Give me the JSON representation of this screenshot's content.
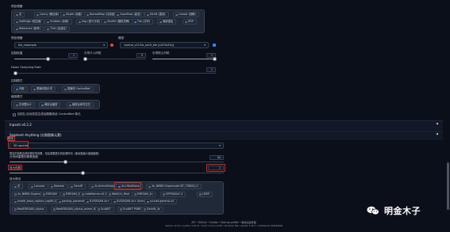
{
  "preprocessor": {
    "title": "预处理器",
    "options": [
      "无",
      "Canny (硬边缘)",
      "Depth (深度)",
      "NormalMap (法线贴图)",
      "OpenPose (姿态)",
      "MLSD (直线)",
      "Lineart (线稿)",
      "SoftEdge (软边缘)",
      "Scribble (涂鸦)",
      "Seg (语义分割)",
      "Shuffle (随机洗牌)",
      "Tile (分块)",
      "局部重绘",
      "IP2P",
      "Reference (参考)",
      "T2IA (自适应)"
    ],
    "selected": "Tile (分块)"
  },
  "preprocessor_select": {
    "label": "预处理器",
    "value": "tile_resample"
  },
  "model_select": {
    "label": "模型",
    "value": "control_v11f1e_sd15_tile [a371b31b]"
  },
  "sliders": {
    "control_weight": {
      "label": "控制权重",
      "value": "1"
    },
    "start_step": {
      "label": "引导介入时机",
      "value": "0"
    },
    "end_step": {
      "label": "引导终止时机",
      "value": "1"
    },
    "down_sampling": {
      "label": "Down Sampling Rate",
      "value": "1"
    }
  },
  "control_mode": {
    "label": "控制模式",
    "options": [
      "均衡",
      "更偏向提示词",
      "更偏向 ControlNet"
    ],
    "selected": "均衡"
  },
  "resize_mode": {
    "label": "缩放模式",
    "options": [
      "仅调整大小",
      "裁剪后缩放",
      "缩放后填充空白"
    ],
    "selected": "裁剪后缩放"
  },
  "loopback": {
    "label": "[回送] 自动发送生成后图像到此 ControlNet 单元"
  },
  "sections": {
    "inpaint": "Inpaint v0.2.2",
    "segment": "Segment Anything (分割图像元素)"
  },
  "script": {
    "label": "脚本",
    "value": "SD upscale",
    "hint": "更高的倍数会得到更好的效果，但会需要更长的处理时间（像素数越大速度越慢）",
    "overlap_label": "分块间重叠的像素宽度",
    "overlap_value": "64",
    "scale_label": "放大倍数",
    "scale_value": "2",
    "upscaler_label": "放大算法"
  },
  "upscalers": [
    [
      "无",
      "Lanczos",
      "Nearest",
      "SwinIR",
      "4x-AnimeSharp",
      "4x-UltraSharp",
      "4x_NMKD-Superscale-SP_178000_G"
    ],
    [
      "4x_NMKD-Superscale_178k",
      "ESRGAN",
      "ESRGAN_4x",
      "codeformer-v0.1.0",
      "Waifu2x_Real",
      "ESRGAN_4x",
      "GFPGANv1.4",
      "LDSR"
    ],
    [
      "model_base_caption_capfilt_large",
      "parsing_parsenet",
      "R-ESRGAN 4x+",
      "R-ESRGAN 4x+ Anime6B",
      "scunet-general-x4"
    ],
    [
      "RealESRGAN_x4plus",
      "RealESRGAN_x4plus_anime_6B",
      "ScuNET",
      "ScuNET PSNR",
      "SwinIR_4x"
    ]
  ],
  "upscaler_selected": "4x-UltraSharp",
  "footer": {
    "links": "API  •  Github  •  Gradio  •  Startup profile  •  重新加载界面",
    "versions": "version: v1.6.0  •  python: 3.10.11  •  torch: 2.0.1+cu118  •  xformers: N/A  •  gradio: 3.41.2  •  checkpoint: 8a5b23bfaf"
  },
  "watermark": "明金木子"
}
